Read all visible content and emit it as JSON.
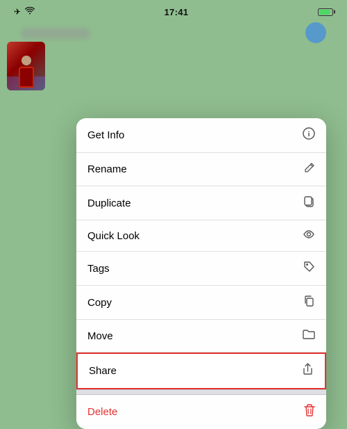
{
  "statusBar": {
    "time": "17:41",
    "icons": {
      "airplane": "✈",
      "wifi": "wifi"
    }
  },
  "colors": {
    "background": "#8fbd8f",
    "menuBg": "rgba(242,242,247,0.97)",
    "shareHighlight": "#e53030",
    "deleteColor": "#e53030"
  },
  "menu": {
    "items": [
      {
        "label": "Get Info",
        "icon": "ℹ",
        "type": "normal"
      },
      {
        "label": "Rename",
        "icon": "✏",
        "type": "normal"
      },
      {
        "label": "Duplicate",
        "icon": "⧉",
        "type": "normal"
      },
      {
        "label": "Quick Look",
        "icon": "👁",
        "type": "normal"
      },
      {
        "label": "Tags",
        "icon": "🏷",
        "type": "normal"
      },
      {
        "label": "Copy",
        "icon": "📋",
        "type": "normal"
      },
      {
        "label": "Move",
        "icon": "📁",
        "type": "normal"
      },
      {
        "label": "Share",
        "icon": "⬆",
        "type": "share"
      }
    ],
    "deleteItem": {
      "label": "Delete",
      "icon": "🗑"
    }
  }
}
